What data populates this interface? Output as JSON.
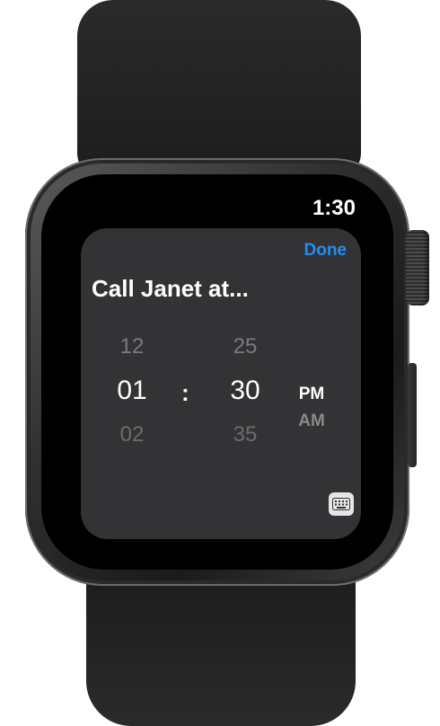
{
  "status": {
    "time": "1:30"
  },
  "toolbar": {
    "done_label": "Done"
  },
  "reminder": {
    "title": "Call Janet at..."
  },
  "picker": {
    "hours": {
      "prev": "12",
      "selected": "01",
      "next": "02"
    },
    "separator": ":",
    "minutes": {
      "prev": "25",
      "selected": "30",
      "next": "35"
    },
    "period": {
      "selected": "PM",
      "next": "AM"
    }
  },
  "icons": {
    "keyboard": "keyboard-icon"
  },
  "colors": {
    "accent": "#1e8ef7",
    "card": "#333335",
    "screen": "#000000"
  }
}
